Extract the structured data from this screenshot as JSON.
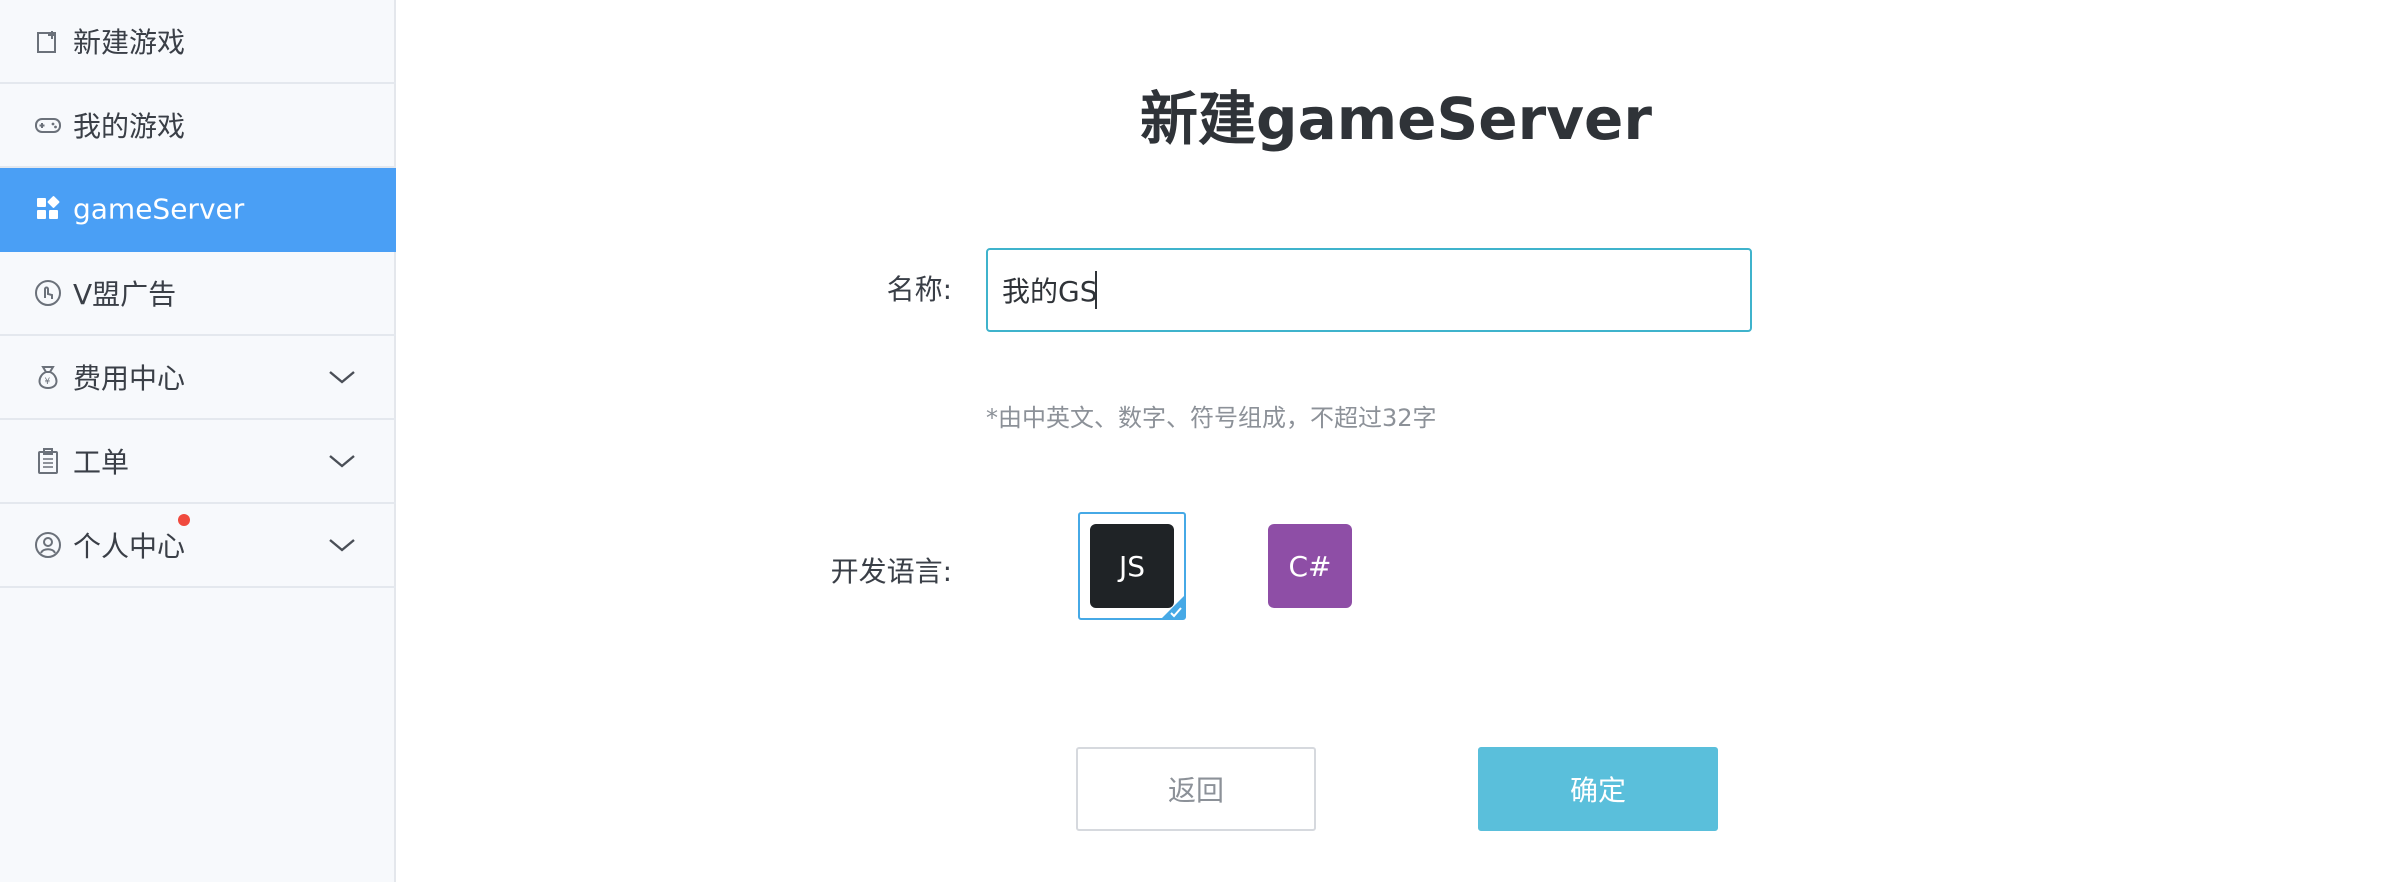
{
  "sidebar": {
    "items": [
      {
        "label": "新建游戏",
        "icon": "new-game-icon",
        "active": false,
        "expandable": false
      },
      {
        "label": "我的游戏",
        "icon": "gamepad-icon",
        "active": false,
        "expandable": false
      },
      {
        "label": "gameServer",
        "icon": "grid-icon",
        "active": true,
        "expandable": false
      },
      {
        "label": "V盟广告",
        "icon": "touch-icon",
        "active": false,
        "expandable": false
      },
      {
        "label": "费用中心",
        "icon": "money-bag-icon",
        "active": false,
        "expandable": true
      },
      {
        "label": "工单",
        "icon": "clipboard-icon",
        "active": false,
        "expandable": true
      },
      {
        "label": "个人中心",
        "icon": "user-circle-icon",
        "active": false,
        "expandable": true,
        "badge": true
      }
    ]
  },
  "main": {
    "title": "新建gameServer",
    "form": {
      "name_label": "名称:",
      "name_value": "我的GS",
      "name_hint": "*由中英文、数字、符号组成，不超过32字",
      "language_label": "开发语言:",
      "languages": [
        {
          "label": "JS",
          "selected": true,
          "color": "#1f2326"
        },
        {
          "label": "C#",
          "selected": false,
          "color": "#8e4ea6"
        }
      ]
    },
    "buttons": {
      "back": "返回",
      "confirm": "确定"
    }
  },
  "colors": {
    "accent": "#4a9ff5",
    "confirm": "#5abfdb",
    "input_border": "#3fb3cc",
    "badge": "#f04a3e"
  }
}
